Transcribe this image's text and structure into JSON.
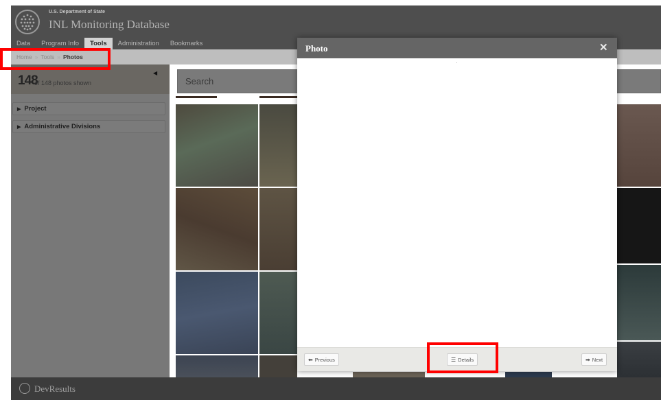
{
  "header": {
    "department": "U.S. Department of State",
    "app_title": "INL Monitoring Database",
    "nav": [
      {
        "label": "Data",
        "active": false
      },
      {
        "label": "Program Info",
        "active": false
      },
      {
        "label": "Tools",
        "active": true
      },
      {
        "label": "Administration",
        "active": false
      },
      {
        "label": "Bookmarks",
        "active": false
      }
    ]
  },
  "breadcrumb": {
    "items": [
      "Home",
      "Tools",
      "Photos"
    ],
    "separator": "»"
  },
  "sidebar": {
    "count": "148",
    "count_text": "of 148 photos shown",
    "facets": [
      "Project",
      "Administrative Divisions"
    ]
  },
  "search": {
    "placeholder": "Search"
  },
  "modal": {
    "title": "Photo",
    "close_glyph": "✕",
    "previous_label": "Previous",
    "details_label": "Details",
    "next_label": "Next"
  },
  "footer": {
    "brand": "DevResults"
  },
  "colors": {
    "highlight": "#ff0000",
    "header_bg": "#4e4e4e",
    "modal_header_bg": "#656565"
  },
  "icons": [
    "globe-seal-icon",
    "collapse-left-icon",
    "caret-right-icon",
    "close-icon",
    "arrow-left-icon",
    "list-icon",
    "arrow-right-icon"
  ]
}
